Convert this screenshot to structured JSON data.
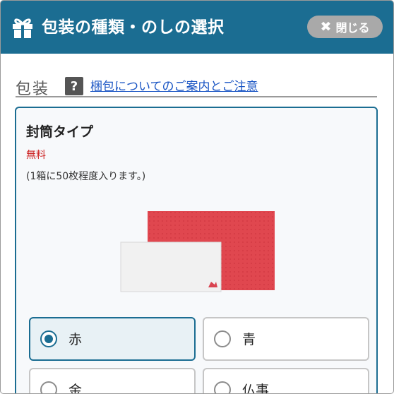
{
  "header": {
    "title": "包装の種類・のしの選択",
    "icon": "gift-icon",
    "close_label": "閉じる",
    "close_icon": "close-icon"
  },
  "section": {
    "title": "包装",
    "help_icon_text": "?",
    "help_link": "梱包についてのご案内とご注意"
  },
  "card": {
    "title": "封筒タイプ",
    "price": "無料",
    "note": "(1箱に50枚程度入ります。)",
    "image": "red-and-white-envelopes"
  },
  "options": [
    {
      "label": "赤",
      "selected": true
    },
    {
      "label": "青",
      "selected": false
    },
    {
      "label": "金",
      "selected": false
    },
    {
      "label": "仏事",
      "selected": false
    }
  ],
  "colors": {
    "header_bg": "#1b6d92",
    "accent": "#1b6d92",
    "price": "#cc1f1f",
    "link": "#1a55c4"
  }
}
